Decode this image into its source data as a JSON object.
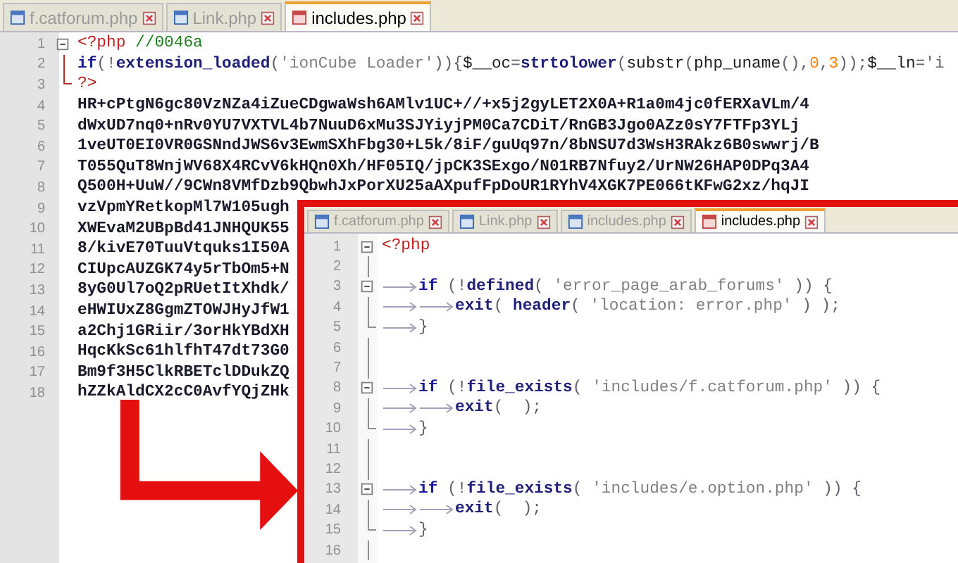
{
  "back_editor": {
    "tabs": [
      {
        "label": "f.catforum.php",
        "selected": false
      },
      {
        "label": "Link.php",
        "selected": false
      },
      {
        "label": "includes.php",
        "selected": true
      }
    ],
    "lines": [
      {
        "number": "1",
        "kind": "foldstart",
        "tokens": [
          {
            "kind": "tag",
            "text": "<?php"
          },
          {
            "kind": "comment",
            "text": " //0046a"
          }
        ]
      },
      {
        "number": "2",
        "kind": "foldbody",
        "tokens": [
          {
            "kind": "keyword",
            "text": "if"
          },
          {
            "kind": "op",
            "text": "(!"
          },
          {
            "kind": "func",
            "text": "extension_loaded"
          },
          {
            "kind": "op",
            "text": "("
          },
          {
            "kind": "string",
            "text": "'ionCube Loader'"
          },
          {
            "kind": "op",
            "text": ")){"
          },
          {
            "kind": "plain",
            "text": "$__oc"
          },
          {
            "kind": "op",
            "text": "="
          },
          {
            "kind": "func",
            "text": "strtolower"
          },
          {
            "kind": "op",
            "text": "("
          },
          {
            "kind": "plain",
            "text": "substr"
          },
          {
            "kind": "op",
            "text": "("
          },
          {
            "kind": "plain",
            "text": "php_uname"
          },
          {
            "kind": "op",
            "text": "(),"
          },
          {
            "kind": "number",
            "text": "0"
          },
          {
            "kind": "op",
            "text": ","
          },
          {
            "kind": "number",
            "text": "3"
          },
          {
            "kind": "op",
            "text": "));"
          },
          {
            "kind": "plain",
            "text": "$__ln"
          },
          {
            "kind": "op",
            "text": "='i"
          }
        ]
      },
      {
        "number": "3",
        "kind": "foldend",
        "tokens": [
          {
            "kind": "tag",
            "text": "?>"
          }
        ]
      },
      {
        "number": "4",
        "kind": "plain",
        "tokens": [
          {
            "kind": "data",
            "text": "HR+cPtgN6gc80VzNZa4iZueCDgwaWsh6AMlv1UC+//+x5j2gyLET2X0A+R1a0m4jc0fERXaVLm/4"
          }
        ]
      },
      {
        "number": "5",
        "kind": "plain",
        "tokens": [
          {
            "kind": "data",
            "text": "dWxUD7nq0+nRv0YU7VXTVL4b7NuuD6xMu3SJYiyjPM0Ca7CDiT/RnGB3Jgo0AZz0sY7FTFp3YLj"
          }
        ]
      },
      {
        "number": "6",
        "kind": "plain",
        "tokens": [
          {
            "kind": "data",
            "text": "1veUT0EI0VR0GSNndJWS6v3EwmSXhFbg30+L5k/8iF/guUq97n/8bNSU7d3WsH3RAkz6B0swwrj/B"
          }
        ]
      },
      {
        "number": "7",
        "kind": "plain",
        "tokens": [
          {
            "kind": "data",
            "text": "T055QuT8WnjWV68X4RCvV6kHQn0Xh/HF05IQ/jpCK3SExgo/N01RB7Nfuy2/UrNW26HAP0DPq3A4"
          }
        ]
      },
      {
        "number": "8",
        "kind": "plain",
        "tokens": [
          {
            "kind": "data",
            "text": "Q500H+UuW//9CWn8VMfDzb9QbwhJxPorXU25aAXpufFpDoUR1RYhV4XGK7PE066tKFwG2xz/hqJI"
          }
        ]
      },
      {
        "number": "9",
        "kind": "plain",
        "tokens": [
          {
            "kind": "data",
            "text": "vzVpmYRetkopMl7W105ugh"
          }
        ]
      },
      {
        "number": "10",
        "kind": "plain",
        "tokens": [
          {
            "kind": "data",
            "text": "XWEvaM2UBpBd41JNHQUK55"
          }
        ]
      },
      {
        "number": "11",
        "kind": "plain",
        "tokens": [
          {
            "kind": "data",
            "text": "8/kivE70TuuVtquks1I50A"
          }
        ]
      },
      {
        "number": "12",
        "kind": "plain",
        "tokens": [
          {
            "kind": "data",
            "text": "CIUpcAUZGK74y5rTbOm5+N"
          }
        ]
      },
      {
        "number": "13",
        "kind": "plain",
        "tokens": [
          {
            "kind": "data",
            "text": "8yG0Ul7oQ2pRUetItXhdk/"
          }
        ]
      },
      {
        "number": "14",
        "kind": "plain",
        "tokens": [
          {
            "kind": "data",
            "text": "eHWIUxZ8GgmZTOWJHyJfW1"
          }
        ]
      },
      {
        "number": "15",
        "kind": "plain",
        "tokens": [
          {
            "kind": "data",
            "text": "a2Chj1GRiir/3orHkYBdXH"
          }
        ]
      },
      {
        "number": "16",
        "kind": "plain",
        "tokens": [
          {
            "kind": "data",
            "text": "HqcKkSc61hlfhT47dt73G0"
          }
        ]
      },
      {
        "number": "17",
        "kind": "plain",
        "tokens": [
          {
            "kind": "data",
            "text": "Bm9f3H5ClkRBETclDDukZQ"
          }
        ]
      },
      {
        "number": "18",
        "kind": "plain",
        "tokens": [
          {
            "kind": "data",
            "text": "hZZkAldCX2cC0AvfYQjZHk"
          }
        ]
      }
    ]
  },
  "front_editor": {
    "tabs": [
      {
        "label": "f.catforum.php",
        "selected": false
      },
      {
        "label": "Link.php",
        "selected": false
      },
      {
        "label": "includes.php",
        "selected": false
      },
      {
        "label": "includes.php",
        "selected": true
      }
    ],
    "lines": [
      {
        "number": "1",
        "kind": "foldstart",
        "tokens": [
          {
            "kind": "tag",
            "text": "<?php"
          }
        ]
      },
      {
        "number": "2",
        "kind": "foldbody"
      },
      {
        "number": "3",
        "kind": "foldstart",
        "tokens": [
          {
            "kind": "tab"
          },
          {
            "kind": "keyword",
            "text": "if"
          },
          {
            "kind": "op",
            "text": " (!"
          },
          {
            "kind": "func",
            "text": "defined"
          },
          {
            "kind": "op",
            "text": "( "
          },
          {
            "kind": "string",
            "text": "'error_page_arab_forums'"
          },
          {
            "kind": "op",
            "text": " )) {"
          }
        ]
      },
      {
        "number": "4",
        "kind": "foldbody",
        "tokens": [
          {
            "kind": "tab"
          },
          {
            "kind": "tab"
          },
          {
            "kind": "func",
            "text": "exit"
          },
          {
            "kind": "op",
            "text": "( "
          },
          {
            "kind": "func",
            "text": "header"
          },
          {
            "kind": "op",
            "text": "( "
          },
          {
            "kind": "string",
            "text": "'location: error.php'"
          },
          {
            "kind": "op",
            "text": " ) );"
          }
        ]
      },
      {
        "number": "5",
        "kind": "foldend",
        "tokens": [
          {
            "kind": "tab"
          },
          {
            "kind": "op",
            "text": "}"
          }
        ]
      },
      {
        "number": "6",
        "kind": "foldbody"
      },
      {
        "number": "7",
        "kind": "foldbody"
      },
      {
        "number": "8",
        "kind": "foldstart",
        "tokens": [
          {
            "kind": "tab"
          },
          {
            "kind": "keyword",
            "text": "if"
          },
          {
            "kind": "op",
            "text": " (!"
          },
          {
            "kind": "func",
            "text": "file_exists"
          },
          {
            "kind": "op",
            "text": "( "
          },
          {
            "kind": "string",
            "text": "'includes/f.catforum.php'"
          },
          {
            "kind": "op",
            "text": " )) {"
          }
        ]
      },
      {
        "number": "9",
        "kind": "foldbody",
        "tokens": [
          {
            "kind": "tab"
          },
          {
            "kind": "tab"
          },
          {
            "kind": "func",
            "text": "exit"
          },
          {
            "kind": "op",
            "text": "(  );"
          }
        ]
      },
      {
        "number": "10",
        "kind": "foldend",
        "tokens": [
          {
            "kind": "tab"
          },
          {
            "kind": "op",
            "text": "}"
          }
        ]
      },
      {
        "number": "11",
        "kind": "foldbody"
      },
      {
        "number": "12",
        "kind": "foldbody"
      },
      {
        "number": "13",
        "kind": "foldstart",
        "tokens": [
          {
            "kind": "tab"
          },
          {
            "kind": "keyword",
            "text": "if"
          },
          {
            "kind": "op",
            "text": " (!"
          },
          {
            "kind": "func",
            "text": "file_exists"
          },
          {
            "kind": "op",
            "text": "( "
          },
          {
            "kind": "string",
            "text": "'includes/e.option.php'"
          },
          {
            "kind": "op",
            "text": " )) {"
          }
        ]
      },
      {
        "number": "14",
        "kind": "foldbody",
        "tokens": [
          {
            "kind": "tab"
          },
          {
            "kind": "tab"
          },
          {
            "kind": "func",
            "text": "exit"
          },
          {
            "kind": "op",
            "text": "(  );"
          }
        ]
      },
      {
        "number": "15",
        "kind": "foldend",
        "tokens": [
          {
            "kind": "tab"
          },
          {
            "kind": "op",
            "text": "}"
          }
        ]
      },
      {
        "number": "16",
        "kind": "foldbody"
      }
    ]
  }
}
